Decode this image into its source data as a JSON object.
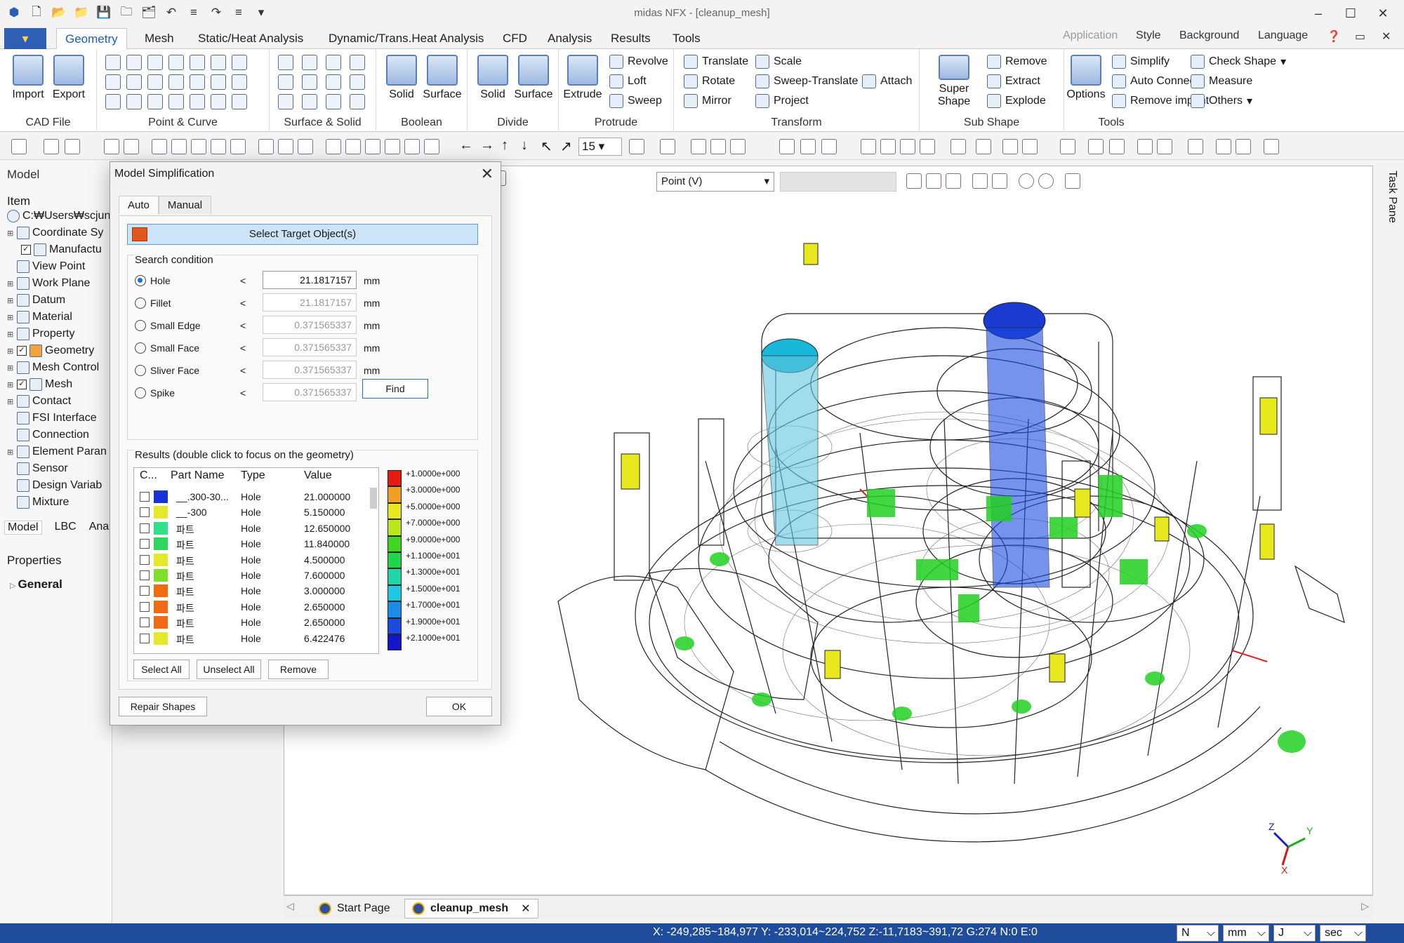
{
  "window": {
    "title": "midas NFX - [cleanup_mesh]"
  },
  "ribbon_tabs": [
    "Geometry",
    "Mesh",
    "Static/Heat Analysis",
    "Dynamic/Trans.Heat Analysis",
    "CFD",
    "Analysis",
    "Results",
    "Tools"
  ],
  "ribbon_right": {
    "application": "Application",
    "style": "Style",
    "background": "Background",
    "language": "Language"
  },
  "ribbon": {
    "groups": [
      "CAD File",
      "Point & Curve",
      "Surface & Solid",
      "Boolean",
      "Divide",
      "Protrude",
      "Transform",
      "Sub Shape",
      "Tools"
    ],
    "import": "Import",
    "export": "Export",
    "boolean_solid": "Solid",
    "boolean_surface": "Surface",
    "divide_solid": "Solid",
    "divide_surface": "Surface",
    "extrude": "Extrude",
    "revolve": "Revolve",
    "loft": "Loft",
    "sweep": "Sweep",
    "translate": "Translate",
    "rotate": "Rotate",
    "mirror": "Mirror",
    "scale": "Scale",
    "sweep_translate": "Sweep-Translate",
    "project": "Project",
    "attach": "Attach",
    "super_shape": "Super Shape",
    "remove": "Remove",
    "extract": "Extract",
    "explode": "Explode",
    "options": "Options",
    "simplify": "Simplify",
    "auto_connect": "Auto Connect",
    "remove_imprint": "Remove imprint",
    "check_shape": "Check Shape",
    "measure": "Measure",
    "others": "Others"
  },
  "toolbar": {
    "zoom_value": "15"
  },
  "left_panel": {
    "title": "Model",
    "tree_header": "Item",
    "items": [
      "C:₩Users₩scjung",
      "Coordinate Sy",
      "Manufactu",
      "View Point",
      "Work Plane",
      "Datum",
      "Material",
      "Property",
      "Geometry",
      "Mesh Control",
      "Mesh",
      "Contact",
      "FSI Interface",
      "Connection",
      "Element Paran",
      "Sensor",
      "Design Variab",
      "Mixture"
    ],
    "tabs": [
      "Model",
      "LBC",
      "Analys"
    ],
    "properties_title": "Properties",
    "properties_section": "General"
  },
  "viewport": {
    "snap_mode": "Point (V)",
    "axes": {
      "x": "X",
      "y": "Y",
      "z": "Z"
    }
  },
  "task_pane": "Task Pane",
  "doc_tabs": [
    "Start Page",
    "cleanup_mesh"
  ],
  "status": {
    "coords": "X: -249,285~184,977 Y: -233,014~224,752 Z:-11,7183~391,72 G:274 N:0 E:0",
    "units": [
      "N",
      "mm",
      "J",
      "sec"
    ]
  },
  "dialog": {
    "title": "Model Simplification",
    "tabs": [
      "Auto",
      "Manual"
    ],
    "select_target": "Select Target Object(s)",
    "search_condition": "Search condition",
    "conditions": [
      {
        "label": "Hole",
        "op": "<",
        "value": "21.1817157",
        "unit": "mm",
        "selected": true
      },
      {
        "label": "Fillet",
        "op": "<",
        "value": "21.1817157",
        "unit": "mm",
        "selected": false
      },
      {
        "label": "Small Edge",
        "op": "<",
        "value": "0.371565337",
        "unit": "mm",
        "selected": false
      },
      {
        "label": "Small Face",
        "op": "<",
        "value": "0.371565337",
        "unit": "mm",
        "selected": false
      },
      {
        "label": "Sliver Face",
        "op": "<",
        "value": "0.371565337",
        "unit": "mm",
        "selected": false
      },
      {
        "label": "Spike",
        "op": "<",
        "value": "0.371565337",
        "unit": "mm",
        "selected": false
      }
    ],
    "find": "Find",
    "results_title": "Results (double click to focus on the geometry)",
    "columns": [
      "C...",
      "Part Name",
      "Type",
      "Value"
    ],
    "rows": [
      {
        "color": "#1533d8",
        "name": "__.300-30...",
        "type": "Hole",
        "value": "21.000000"
      },
      {
        "color": "#e6e82a",
        "name": "__-300",
        "type": "Hole",
        "value": "5.150000"
      },
      {
        "color": "#30e08a",
        "name": "파트",
        "type": "Hole",
        "value": "12.650000"
      },
      {
        "color": "#2fd65a",
        "name": "파트",
        "type": "Hole",
        "value": "11.840000"
      },
      {
        "color": "#e6e82a",
        "name": "파트",
        "type": "Hole",
        "value": "4.500000"
      },
      {
        "color": "#7ee02a",
        "name": "파트",
        "type": "Hole",
        "value": "7.600000"
      },
      {
        "color": "#f26a12",
        "name": "파트",
        "type": "Hole",
        "value": "3.000000"
      },
      {
        "color": "#f26a12",
        "name": "파트",
        "type": "Hole",
        "value": "2.650000"
      },
      {
        "color": "#f26a12",
        "name": "파트",
        "type": "Hole",
        "value": "2.650000"
      },
      {
        "color": "#e6e82a",
        "name": "파트",
        "type": "Hole",
        "value": "6.422476"
      }
    ],
    "legend": [
      {
        "label": "+1.0000e+000",
        "color": "#e81a14"
      },
      {
        "label": "+3.0000e+000",
        "color": "#f0a020"
      },
      {
        "label": "+5.0000e+000",
        "color": "#e8e81e"
      },
      {
        "label": "+7.0000e+000",
        "color": "#b8e81a"
      },
      {
        "label": "+9.0000e+000",
        "color": "#3ed61e"
      },
      {
        "label": "+1.1000e+001",
        "color": "#1ed64a"
      },
      {
        "label": "+1.3000e+001",
        "color": "#1ed6a8"
      },
      {
        "label": "+1.5000e+001",
        "color": "#1ec8e0"
      },
      {
        "label": "+1.7000e+001",
        "color": "#1a8ce8"
      },
      {
        "label": "+1.9000e+001",
        "color": "#1a4ae0"
      },
      {
        "label": "+2.1000e+001",
        "color": "#1414c8"
      }
    ],
    "select_all": "Select All",
    "unselect_all": "Unselect All",
    "remove": "Remove",
    "repair_shapes": "Repair Shapes",
    "ok": "OK"
  }
}
